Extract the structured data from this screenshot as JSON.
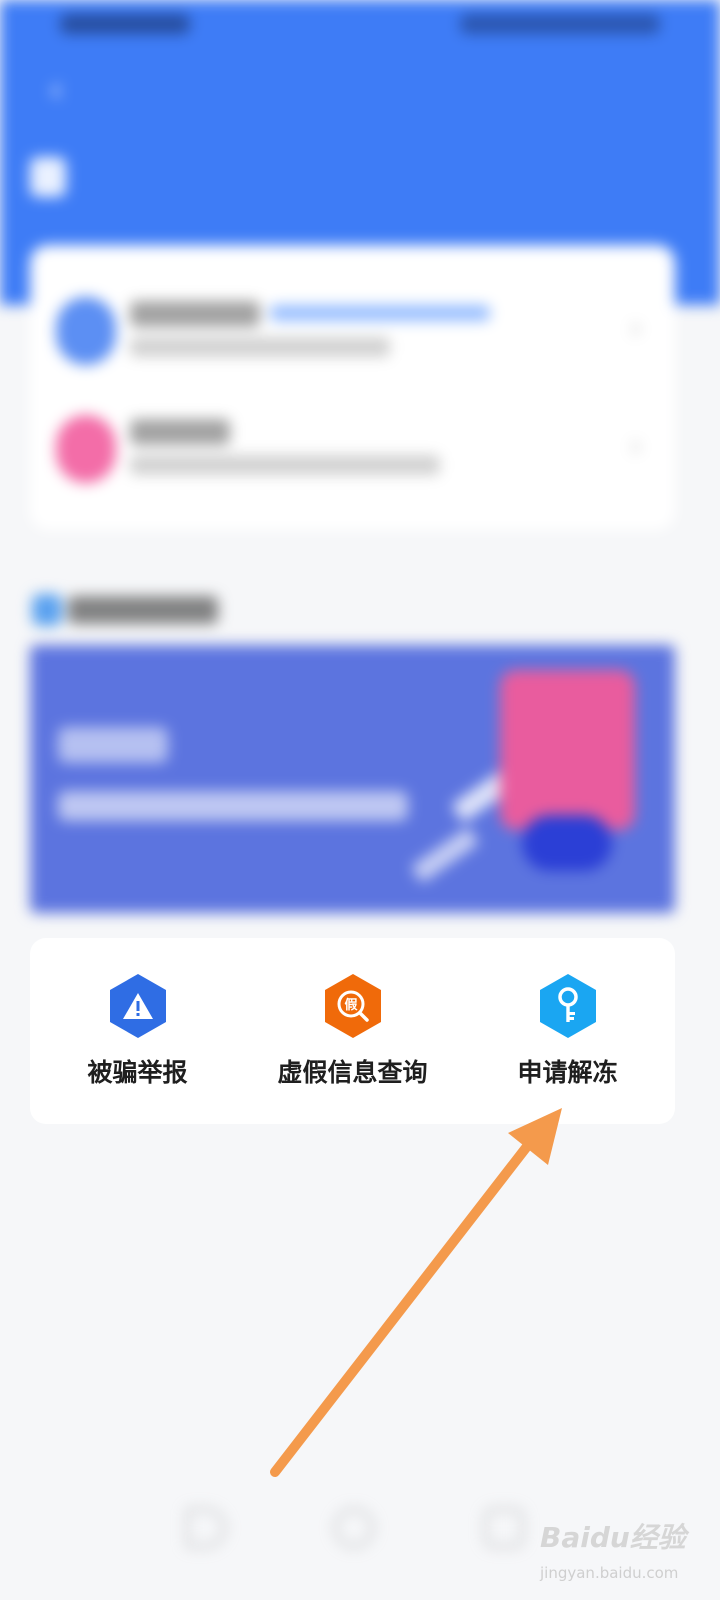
{
  "colors": {
    "header_blue": "#3e7cf6",
    "report_icon": "#2f6de4",
    "fake_info_icon": "#f06a0a",
    "unfreeze_icon": "#1aa6f2",
    "arrow": "#f49a4c"
  },
  "header": {
    "back_icon": "back-arrow-icon"
  },
  "services": [
    {
      "label": "被骗举报",
      "icon": "warning-icon"
    },
    {
      "label": "虚假信息查询",
      "icon": "fake-search-icon",
      "icon_text": "假"
    },
    {
      "label": "申请解冻",
      "icon": "key-icon"
    }
  ],
  "watermark": {
    "logo": "Baidu经验",
    "url": "jingyan.baidu.com"
  }
}
